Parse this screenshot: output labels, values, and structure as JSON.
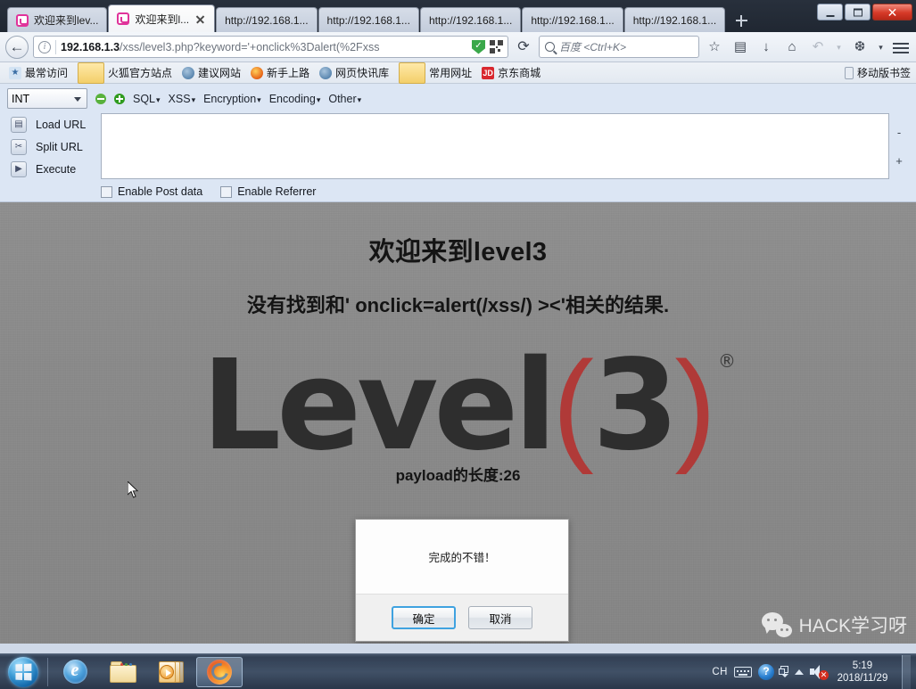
{
  "window": {
    "minimize_label": "–",
    "maximize_label": "□",
    "close_label": "✕"
  },
  "tabs": [
    {
      "title": "欢迎来到lev...",
      "active": false
    },
    {
      "title": "欢迎来到l...",
      "active": true
    },
    {
      "title": "http://192.168.1...",
      "active": false
    },
    {
      "title": "http://192.168.1...",
      "active": false
    },
    {
      "title": "http://192.168.1...",
      "active": false
    },
    {
      "title": "http://192.168.1...",
      "active": false
    },
    {
      "title": "http://192.168.1...",
      "active": false
    }
  ],
  "newtab_label": "+",
  "navbar": {
    "back_label": "←",
    "url_host": "192.168.1.3",
    "url_path": "/xss/level3.php?keyword='+onclick%3Dalert(%2Fxss",
    "reload_label": "⟳",
    "search_placeholder": "百度 <Ctrl+K>",
    "bookmark_star": "☆",
    "reader_label": "▤",
    "downloads_label": "↓",
    "home_label": "⌂",
    "history_label": "↶",
    "history_caret": "▾",
    "addon_label": "❆",
    "addon_caret": "▾"
  },
  "bookmarks": {
    "items": [
      {
        "label": "最常访问",
        "icon": "star-icon",
        "icon_text": "★"
      },
      {
        "label": "火狐官方站点",
        "icon": "folder-icon",
        "icon_text": ""
      },
      {
        "label": "建议网站",
        "icon": "globe-icon",
        "icon_text": ""
      },
      {
        "label": "新手上路",
        "icon": "firefox-icon",
        "icon_text": ""
      },
      {
        "label": "网页快讯库",
        "icon": "globe-icon",
        "icon_text": ""
      },
      {
        "label": "常用网址",
        "icon": "folder-icon",
        "icon_text": ""
      },
      {
        "label": "京东商城",
        "icon": "jd-icon",
        "icon_text": "JD"
      }
    ],
    "mobile_label": "移动版书签"
  },
  "hackbar": {
    "type_select": "INT",
    "minus_label": "−",
    "plus_label": "+",
    "menus": [
      {
        "label": "SQL",
        "caret": "▾"
      },
      {
        "label": "XSS",
        "caret": "▾"
      },
      {
        "label": "Encryption",
        "caret": "▾"
      },
      {
        "label": "Encoding",
        "caret": "▾"
      },
      {
        "label": "Other",
        "caret": "▾"
      }
    ],
    "actions": [
      {
        "label": "Load URL",
        "icon": "load-url-icon",
        "glyph": "▤"
      },
      {
        "label": "Split URL",
        "icon": "scissors-icon",
        "glyph": "✂"
      },
      {
        "label": "Execute",
        "icon": "play-icon",
        "glyph": "▶"
      }
    ],
    "textarea_value": "",
    "zoom_out": "-",
    "zoom_in": "+",
    "checks": [
      {
        "label": "Enable Post data",
        "checked": false
      },
      {
        "label": "Enable Referrer",
        "checked": false
      }
    ]
  },
  "page": {
    "heading": "欢迎来到level3",
    "subheading": "没有找到和' onclick=alert(/xss/) ><'相关的结果.",
    "logo_text": "Level",
    "logo_paren_open": "(",
    "logo_number": "3",
    "logo_paren_close": ")",
    "logo_registered": "®",
    "payload_text": "payload的长度:26",
    "watermark": "HACK学习呀",
    "colors": {
      "background": "#8b8b8b",
      "logo_dark": "#2e2e2e",
      "logo_red": "#b03a38"
    }
  },
  "dialog": {
    "message": "完成的不错！",
    "confirm_label": "确定",
    "cancel_label": "取消",
    "focus_color": "#3fa2e0"
  },
  "taskbar": {
    "buttons": [
      {
        "name": "internet-explorer",
        "label": ""
      },
      {
        "name": "file-explorer",
        "label": ""
      },
      {
        "name": "windows-media-player",
        "label": ""
      },
      {
        "name": "firefox",
        "label": "",
        "active": true
      }
    ],
    "tray": {
      "ime_label": "CH",
      "help_label": "?",
      "up_arrow": "▲",
      "time": "5:19",
      "date": "2018/11/29"
    }
  }
}
